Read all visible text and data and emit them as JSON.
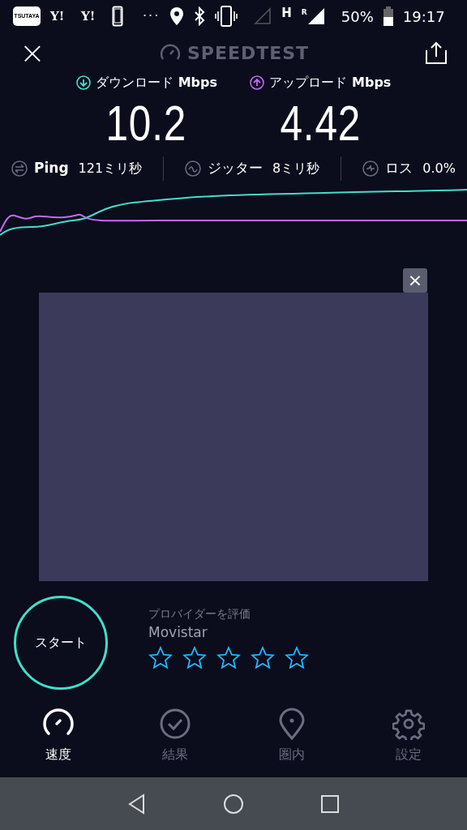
{
  "status_bar": {
    "app_icons": [
      "TSUTAYA",
      "Y!",
      "Y!"
    ],
    "more": "···",
    "network_type": "H",
    "roaming": "R",
    "battery": "50%",
    "time": "19:17"
  },
  "header": {
    "close": "×",
    "title": "SPEEDTEST"
  },
  "results": [
    {
      "kind": "download",
      "label": "ダウンロード",
      "unit": "Mbps",
      "value": "10.2",
      "color": "#3fe0c9"
    },
    {
      "kind": "upload",
      "label": "アップロード",
      "unit": "Mbps",
      "value": "4.42",
      "color": "#bf6cf0"
    }
  ],
  "metrics": [
    {
      "kind": "ping",
      "label": "Ping",
      "value": "121ミリ秒"
    },
    {
      "kind": "jitter",
      "label": "ジッター",
      "value": "8ミリ秒"
    },
    {
      "kind": "loss",
      "label": "ロス",
      "value": "0.0%"
    }
  ],
  "ad": {
    "close": "×"
  },
  "start_button": "スタート",
  "rating": {
    "prompt": "プロバイダーを評価",
    "provider": "Movistar",
    "stars": 0
  },
  "nav": [
    {
      "label": "速度",
      "selected": true
    },
    {
      "label": "結果",
      "selected": false
    },
    {
      "label": "圏内",
      "selected": false
    },
    {
      "label": "設定",
      "selected": false
    }
  ]
}
